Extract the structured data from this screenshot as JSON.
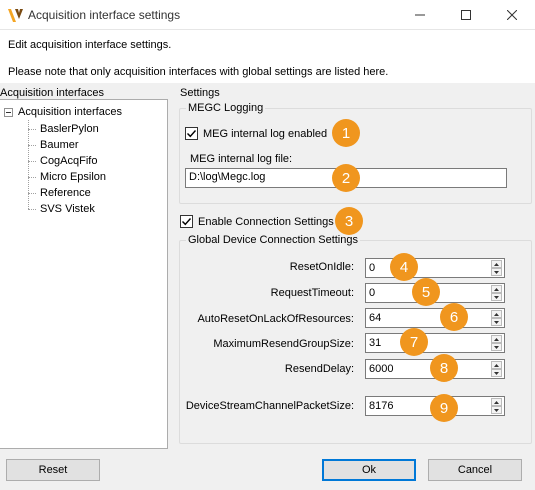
{
  "window": {
    "title": "Acquisition interface settings"
  },
  "header": {
    "line1": "Edit acquisition interface settings.",
    "line2": "Please note that only acquisition interfaces with global settings are listed here."
  },
  "tree": {
    "label": "Acquisition interfaces",
    "root": "Acquisition interfaces",
    "items": [
      "BaslerPylon",
      "Baumer",
      "CogAcqFifo",
      "Micro Epsilon",
      "Reference",
      "SVS Vistek"
    ]
  },
  "settings": {
    "label": "Settings",
    "megc_logging": {
      "legend": "MEGC Logging",
      "internal_log_label": "MEG internal log enabled",
      "internal_log_checked": true,
      "log_file_label": "MEG internal log file:",
      "log_file_value": "D:\\log\\Megc.log"
    },
    "enable_connection": {
      "label": "Enable Connection Settings",
      "checked": true
    },
    "global": {
      "legend": "Global Device Connection Settings",
      "fields": [
        {
          "label": "ResetOnIdle:",
          "value": "0"
        },
        {
          "label": "RequestTimeout:",
          "value": "0"
        },
        {
          "label": "AutoResetOnLackOfResources:",
          "value": "64"
        },
        {
          "label": "MaximumResendGroupSize:",
          "value": "31"
        },
        {
          "label": "ResendDelay:",
          "value": "6000"
        },
        {
          "label": "DeviceStreamChannelPacketSize:",
          "value": "8176"
        }
      ]
    }
  },
  "badges": [
    "1",
    "2",
    "3",
    "4",
    "5",
    "6",
    "7",
    "8",
    "9"
  ],
  "buttons": {
    "reset": "Reset",
    "ok": "Ok",
    "cancel": "Cancel"
  },
  "colors": {
    "badge": "#f0961e",
    "accent": "#0078d7"
  }
}
